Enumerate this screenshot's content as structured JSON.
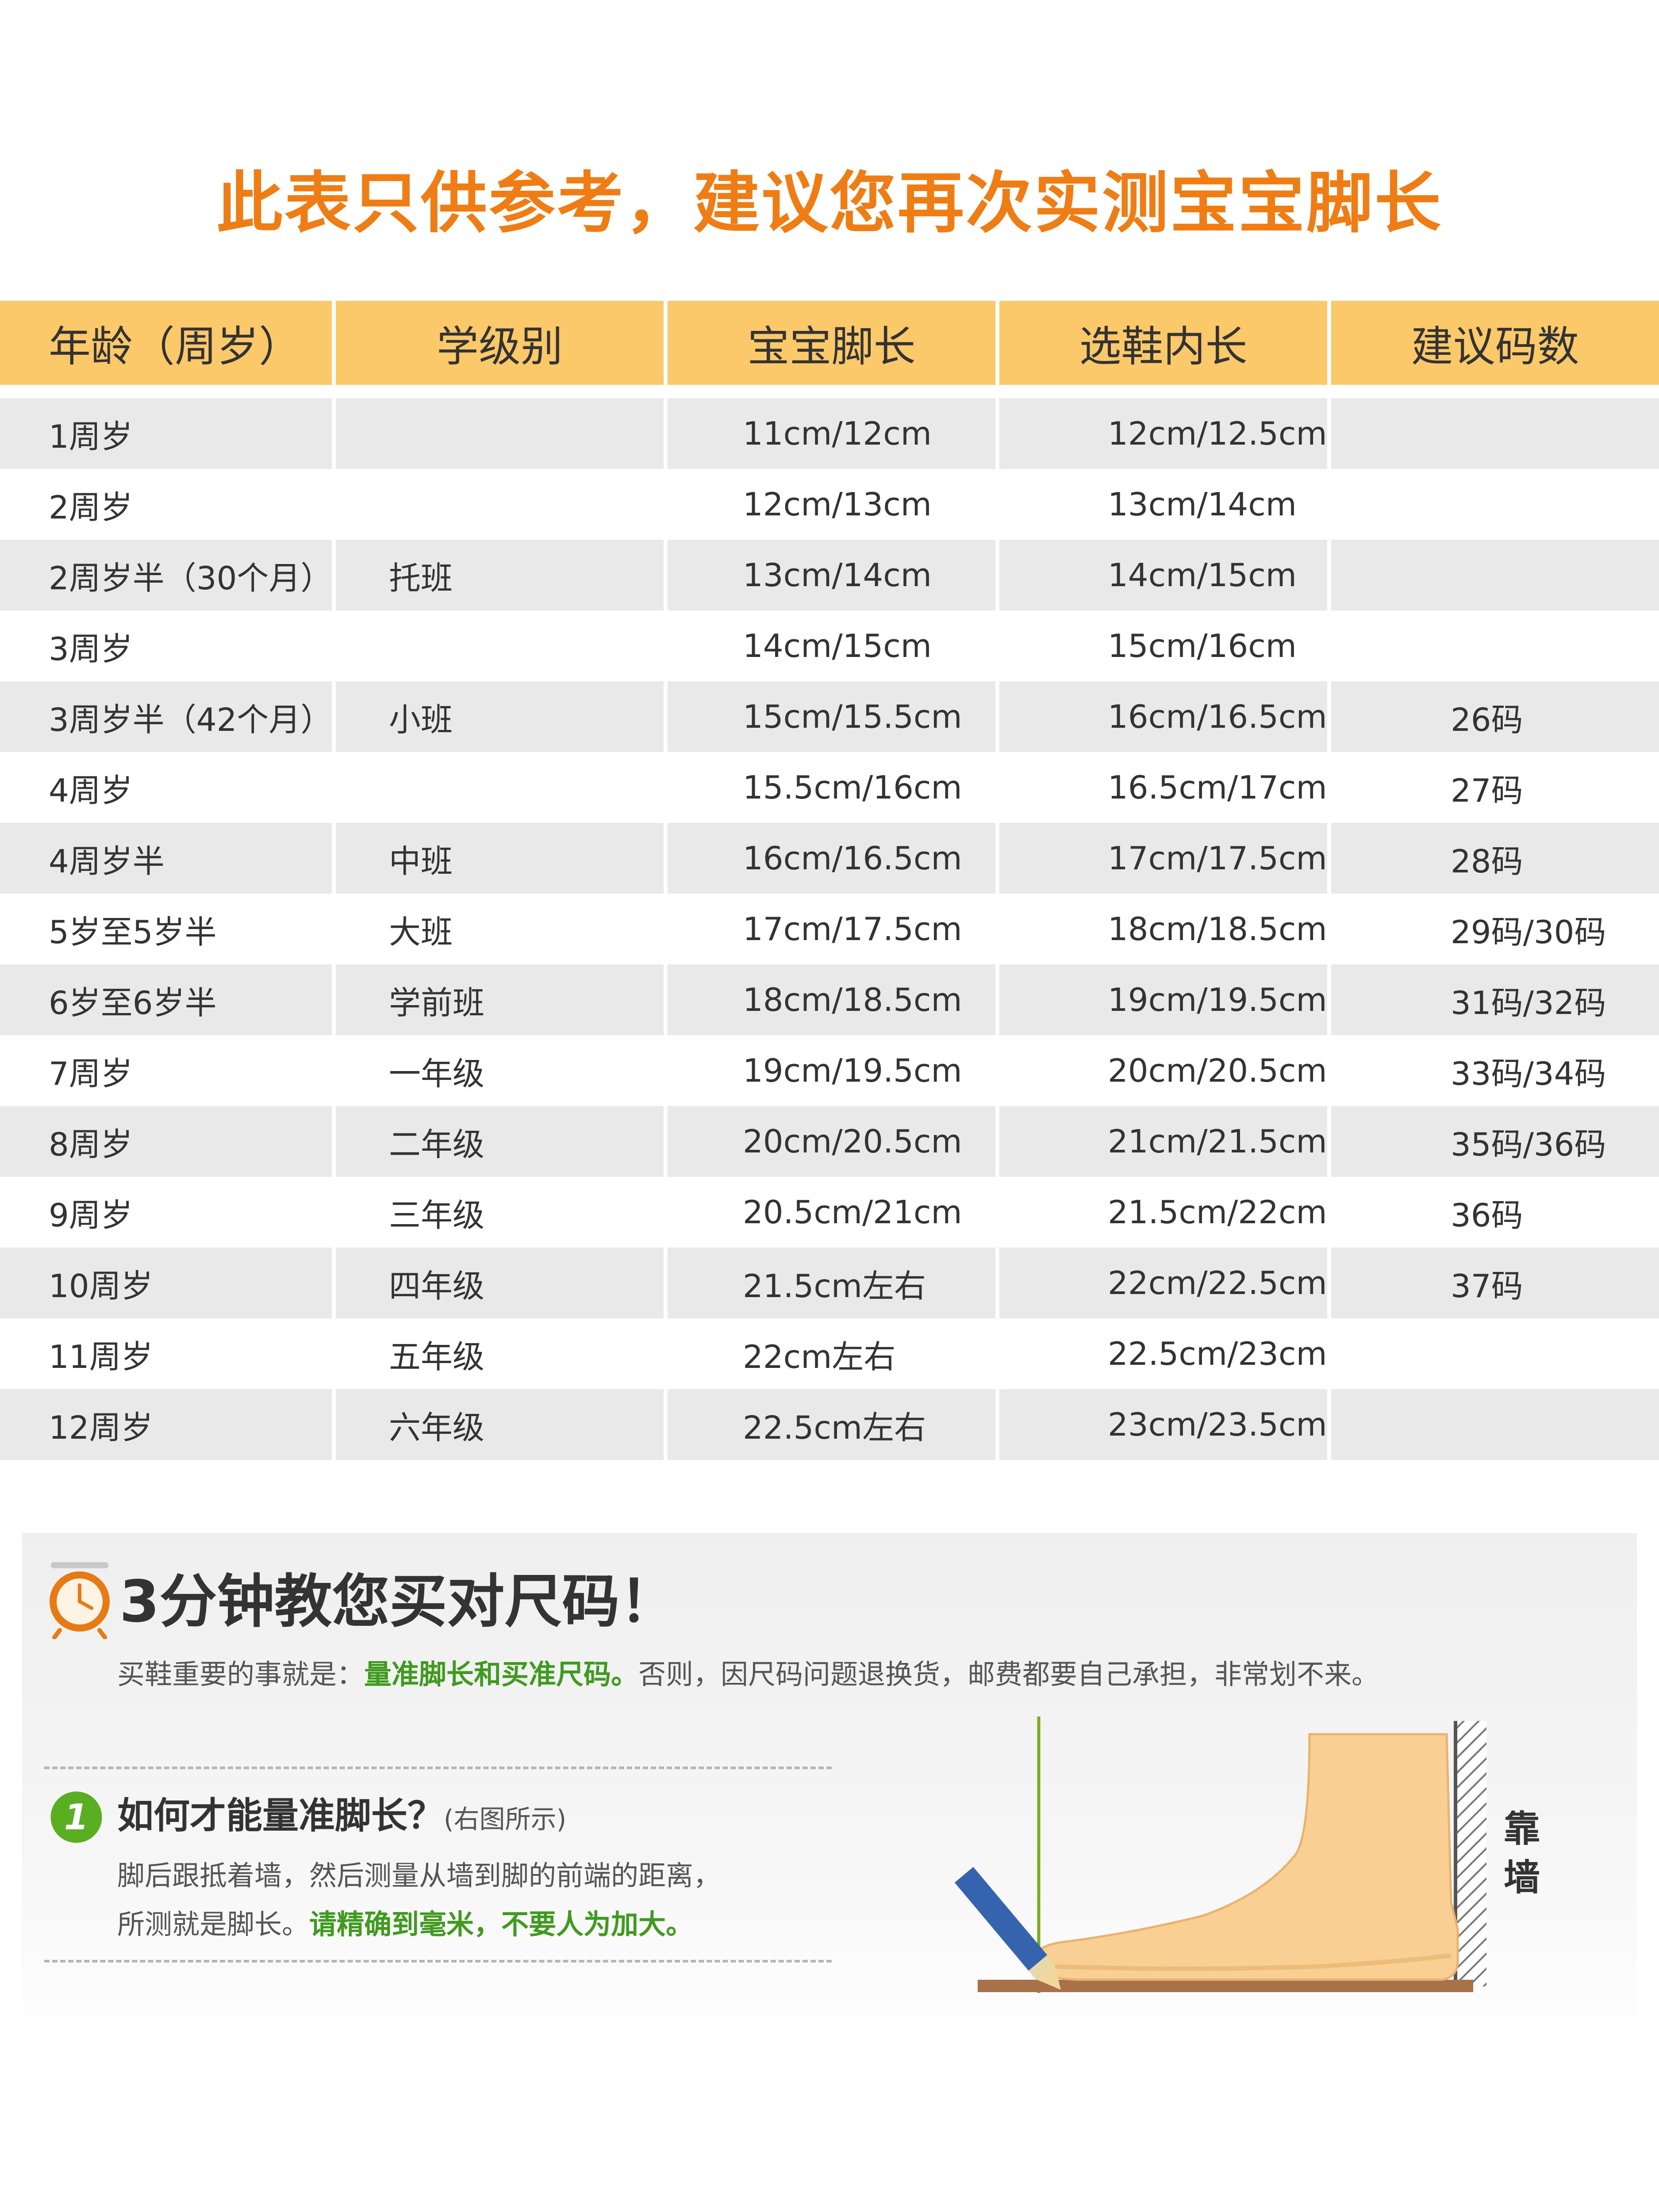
{
  "title": "此表只供参考，建议您再次实测宝宝脚长",
  "colors": {
    "title": "#f07c14",
    "header_bg": "#fcc96a",
    "row_stripe": "#e9e9e9",
    "row_plain": "#ffffff",
    "highlight_green": "#3f9b1e",
    "badge_green": "#5aae22",
    "clock_orange": "#e87a13",
    "foot_skin": "#f9cf93",
    "floor": "#a9714a",
    "pencil_blue": "#3563ae",
    "guide_line": "#7cab1e"
  },
  "table": {
    "headers": [
      "年龄（周岁）",
      "学级别",
      "宝宝脚长",
      "选鞋内长",
      "建议码数"
    ],
    "rows": [
      [
        "1周岁",
        "",
        "11cm/12cm",
        "12cm/12.5cm",
        ""
      ],
      [
        "2周岁",
        "",
        "12cm/13cm",
        "13cm/14cm",
        ""
      ],
      [
        "2周岁半（30个月）",
        "托班",
        "13cm/14cm",
        "14cm/15cm",
        ""
      ],
      [
        "3周岁",
        "",
        "14cm/15cm",
        "15cm/16cm",
        ""
      ],
      [
        "3周岁半（42个月）",
        "小班",
        "15cm/15.5cm",
        "16cm/16.5cm",
        "26码"
      ],
      [
        "4周岁",
        "",
        "15.5cm/16cm",
        "16.5cm/17cm",
        "27码"
      ],
      [
        "4周岁半",
        "中班",
        "16cm/16.5cm",
        "17cm/17.5cm",
        "28码"
      ],
      [
        "5岁至5岁半",
        "大班",
        "17cm/17.5cm",
        "18cm/18.5cm",
        "29码/30码"
      ],
      [
        "6岁至6岁半",
        "学前班",
        "18cm/18.5cm",
        "19cm/19.5cm",
        "31码/32码"
      ],
      [
        "7周岁",
        "一年级",
        "19cm/19.5cm",
        "20cm/20.5cm",
        "33码/34码"
      ],
      [
        "8周岁",
        "二年级",
        "20cm/20.5cm",
        "21cm/21.5cm",
        "35码/36码"
      ],
      [
        "9周岁",
        "三年级",
        "20.5cm/21cm",
        "21.5cm/22cm",
        "36码"
      ],
      [
        "10周岁",
        "四年级",
        "21.5cm左右",
        "22cm/22.5cm",
        "37码"
      ],
      [
        "11周岁",
        "五年级",
        "22cm左右",
        "22.5cm/23cm",
        ""
      ],
      [
        "12周岁",
        "六年级",
        "22.5cm左右",
        "23cm/23.5cm",
        ""
      ]
    ]
  },
  "guide": {
    "heading": "3分钟教您买对尺码！",
    "heading_icon": "alarm-clock-icon",
    "intro_before": "买鞋重要的事就是：",
    "intro_highlight": "量准脚长和买准尺码。",
    "intro_after": "否则，因尺码问题退换货，邮费都要自己承担，非常划不来。",
    "step": {
      "number": "1",
      "title": "如何才能量准脚长？",
      "title_note": "(右图所示)",
      "line1": "脚后跟抵着墙，然后测量从墙到脚的前端的距离，",
      "line2_before": "所测就是脚长。",
      "line2_highlight": "请精确到毫米，不要人为加大。"
    },
    "wall_label": "靠墙"
  }
}
